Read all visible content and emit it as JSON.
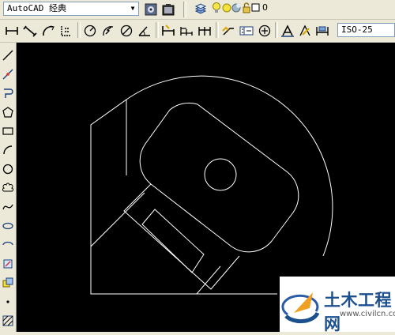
{
  "workspace": {
    "selected": "AutoCAD 经典"
  },
  "layer": {
    "name": "0"
  },
  "dimstyle": {
    "selected": "ISO-25"
  },
  "watermark": {
    "brand": "土木工程网",
    "url": "www.civilcn.com"
  },
  "colors": {
    "toolbar_bg": "#ece9d8",
    "canvas_bg": "#000000",
    "drawing_stroke": "#ffffff",
    "brand": "#1b4f8e"
  }
}
